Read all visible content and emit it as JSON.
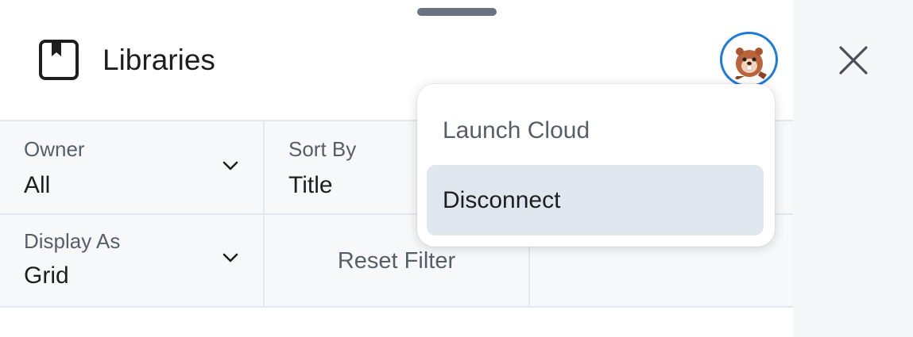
{
  "header": {
    "title": "Libraries",
    "icon": "library-book-icon",
    "avatar_icon": "beaver-avatar-icon",
    "close_icon": "close-icon"
  },
  "filters": {
    "owner": {
      "label": "Owner",
      "value": "All"
    },
    "sort_by": {
      "label": "Sort By",
      "value": "Title"
    },
    "display_as": {
      "label": "Display As",
      "value": "Grid"
    },
    "reset_label": "Reset Filter"
  },
  "account_menu": {
    "items": [
      {
        "label": "Launch Cloud"
      },
      {
        "label": "Disconnect",
        "highlighted": true
      }
    ]
  },
  "colors": {
    "accent_ring": "#1e7bd9",
    "menu_highlight": "#e1e7ef",
    "filter_background": "#f7f8fa",
    "side_background": "#f6f7f9"
  }
}
